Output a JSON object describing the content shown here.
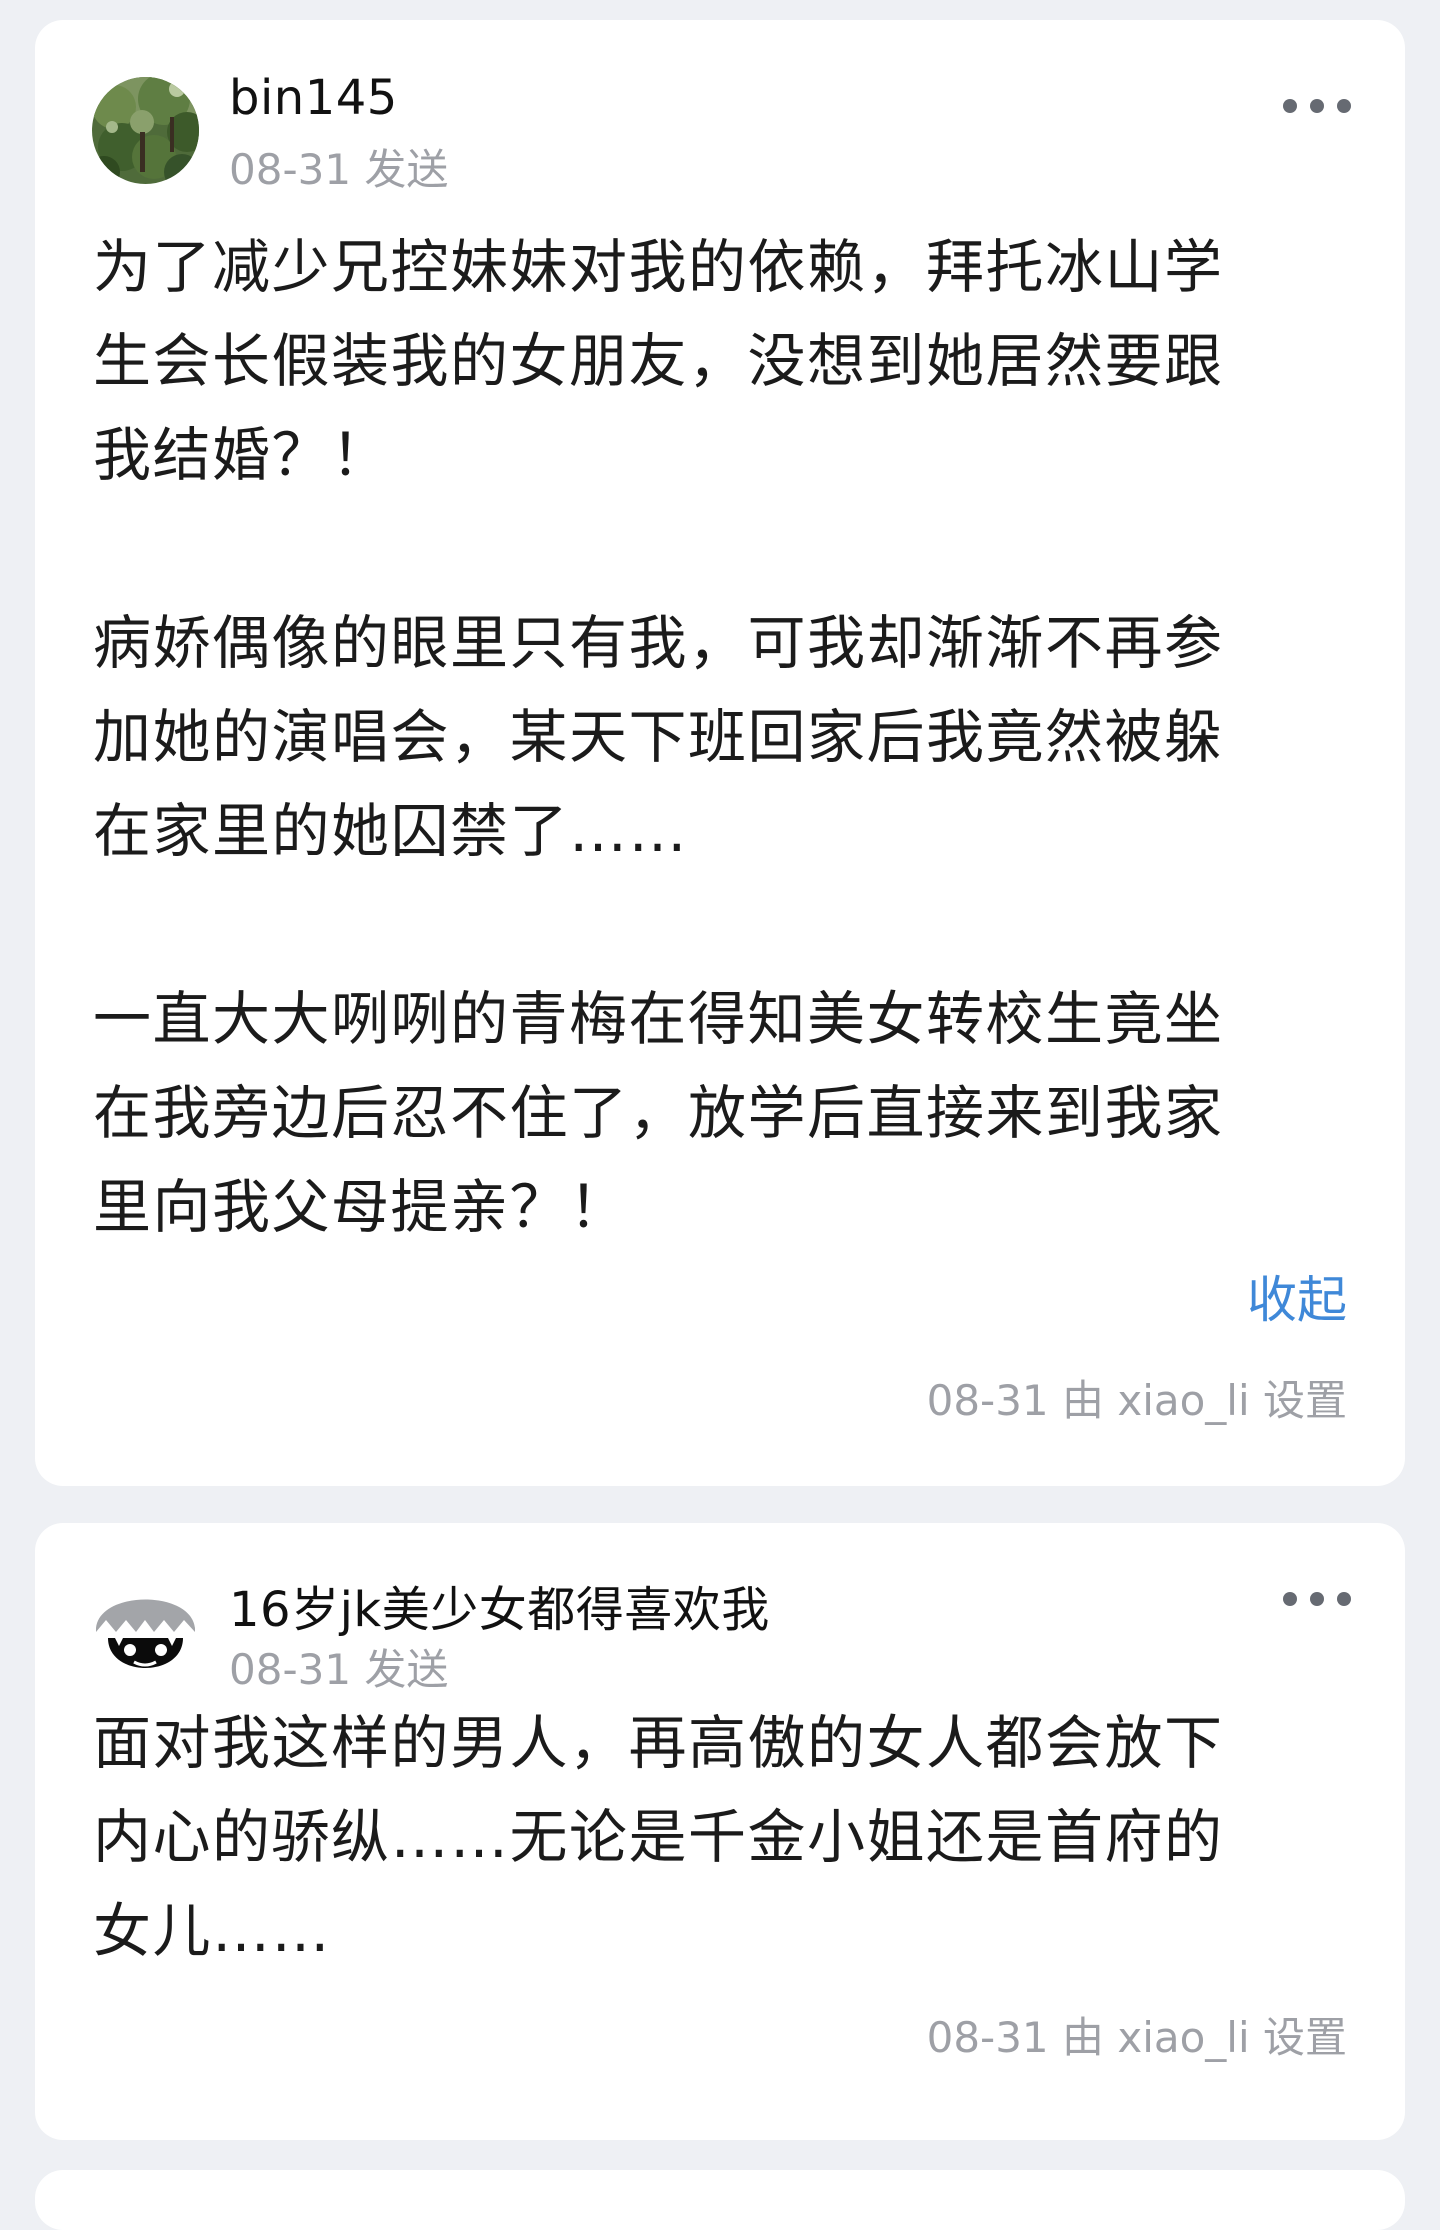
{
  "posts": [
    {
      "username": "bin145",
      "meta": "08-31 发送",
      "avatar_icon": "landscape-photo-avatar",
      "paragraphs": [
        "为了减少兄控妹妹对我的依赖，拜托冰山学\n生会长假装我的女朋友，没想到她居然要跟\n我结婚？！",
        "病娇偶像的眼里只有我，可我却渐渐不再参\n加她的演唱会，某天下班回家后我竟然被躲\n在家里的她囚禁了……",
        "一直大大咧咧的青梅在得知美女转校生竟坐\n在我旁边后忍不住了，放学后直接来到我家\n里向我父母提亲？！"
      ],
      "collapse_label": "收起",
      "footer": "08-31 由 xiao_li 设置"
    },
    {
      "username": "16岁jk美少女都得喜欢我",
      "meta": "08-31 发送",
      "avatar_icon": "cartoon-face-avatar",
      "paragraphs": [
        "面对我这样的男人，再高傲的女人都会放下\n内心的骄纵……无论是千金小姐还是首府的\n女儿……"
      ],
      "footer": "08-31 由 xiao_li 设置"
    }
  ],
  "colors": {
    "page_background": "#eef0f4",
    "card_background": "#ffffff",
    "link": "#3f88d8",
    "muted_text": "#9ea0a6",
    "body_text": "#1b1b1b"
  }
}
